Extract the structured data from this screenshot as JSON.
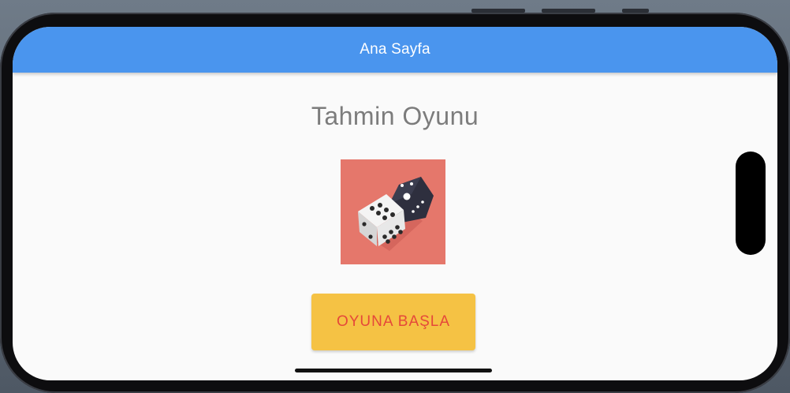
{
  "appbar": {
    "title": "Ana Sayfa",
    "color": "#4a95ee"
  },
  "main": {
    "heading": "Tahmin Oyunu",
    "image": {
      "icon": "dice-icon",
      "background": "#e5776b"
    },
    "start_button": {
      "label": "OYUNA BAŞLA",
      "background": "#f5c244",
      "text_color": "#e5483a"
    }
  }
}
